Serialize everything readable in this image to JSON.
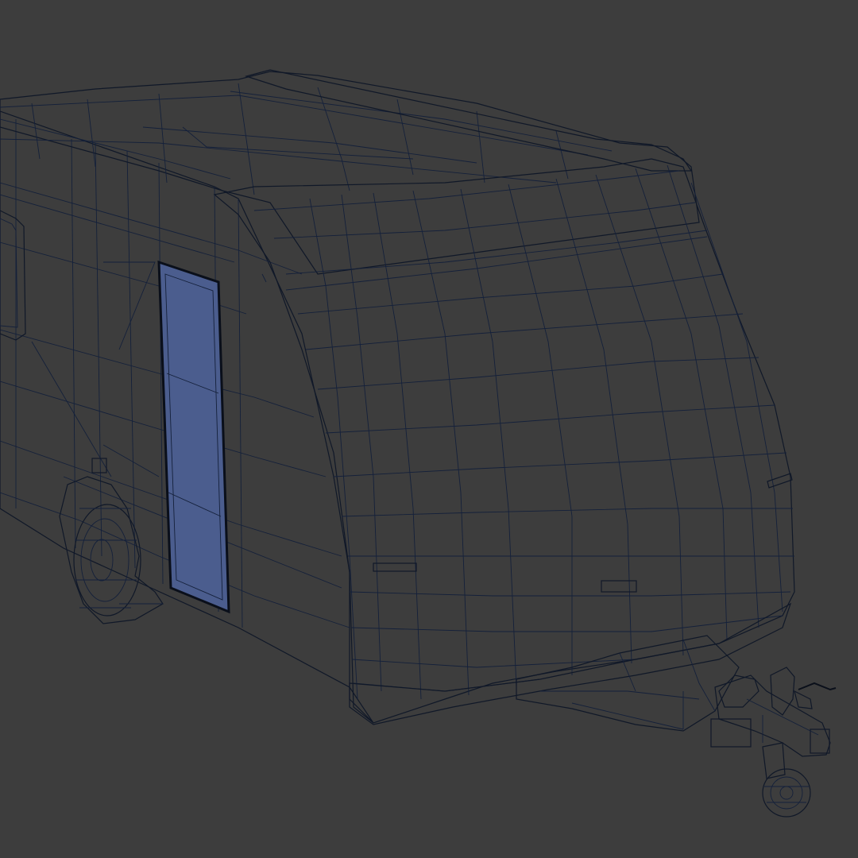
{
  "scene": {
    "subject": "caravan-trailer-wireframe",
    "colors": {
      "background": "#3d3d3d",
      "surface_light": "#8fa6e0",
      "surface_mid": "#6f86c2",
      "surface_dark": "#4a5c8c",
      "surface_shadow": "#3a4870",
      "wire": "#101828"
    }
  }
}
